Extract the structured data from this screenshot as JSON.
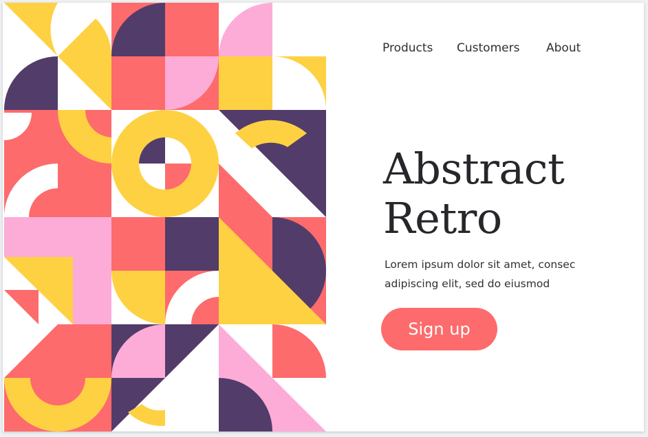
{
  "nav": {
    "products": "Products",
    "customers": "Customers",
    "about": "About"
  },
  "hero": {
    "title_line1": "Abstract",
    "title_line2": "Retro",
    "subtitle_line1": "Lorem ipsum dolor sit amet, consec",
    "subtitle_line2": "adipiscing elit, sed do eiusmod",
    "cta_label": "Sign up"
  },
  "colors": {
    "yellow": "#fed142",
    "coral": "#fd6b6c",
    "purple": "#523c6a",
    "pink": "#fdacd7",
    "white": "#ffffff",
    "text": "#26262b"
  },
  "icons": {
    "pattern": "geometric-mosaic-illustration"
  }
}
